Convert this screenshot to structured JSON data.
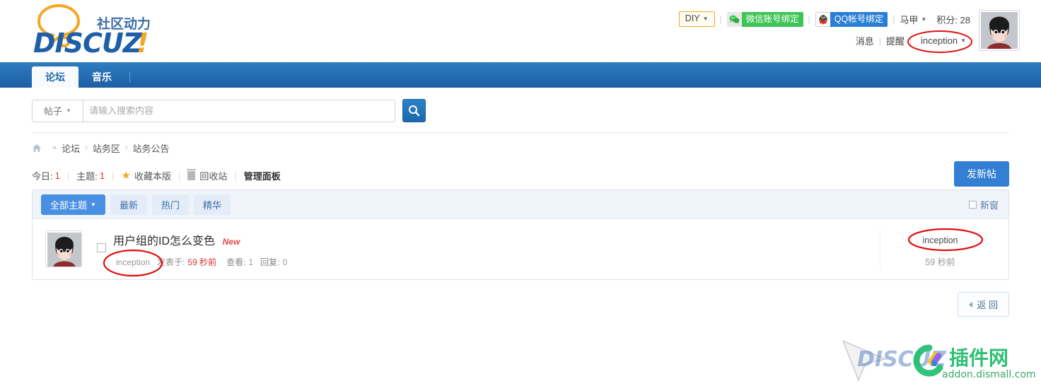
{
  "header": {
    "logo_text": "DISCUZ!",
    "logo_sub": "社区动力",
    "diy_label": "DIY",
    "wechat_bind": "微信账号绑定",
    "qq_bind": "QQ帐号绑定",
    "vest_label": "马甲",
    "points_label": "积分: 28",
    "messages": "消息",
    "reminders": "提醒",
    "username": "inception",
    "separator": "|"
  },
  "nav": {
    "tabs": [
      {
        "label": "论坛",
        "active": true
      },
      {
        "label": "音乐",
        "active": false
      }
    ]
  },
  "search": {
    "scope_label": "帖子",
    "placeholder": "请输入搜索内容",
    "value": "",
    "button_icon": "search-icon"
  },
  "breadcrumb": {
    "home_icon": "home-icon",
    "separator_first": "»",
    "items": [
      "论坛",
      "站务区",
      "站务公告"
    ],
    "arrow": "›"
  },
  "forumbar": {
    "today_label": "今日:",
    "today_count": "1",
    "threads_label": "主题:",
    "threads_count": "1",
    "favorite": "收藏本版",
    "recycle": "回收站",
    "manage_panel": "管理面板",
    "new_thread": "发新帖",
    "divider": "|"
  },
  "list_header": {
    "filters": [
      {
        "label": "全部主题",
        "active": true,
        "has_caret": true
      },
      {
        "label": "最新",
        "active": false,
        "has_caret": false
      },
      {
        "label": "热门",
        "active": false,
        "has_caret": false
      },
      {
        "label": "精华",
        "active": false,
        "has_caret": false
      }
    ],
    "new_window": "新窗"
  },
  "threads": [
    {
      "title": "用户组的ID怎么变色",
      "badge": "New",
      "author": "inception",
      "posted_label": "发表于:",
      "posted_time": "59 秒前",
      "views_label": "查看:",
      "views": "1",
      "replies_label": "回复:",
      "replies": "0",
      "last_poster": "inception",
      "last_time": "59 秒前"
    }
  ],
  "footer": {
    "back_label": "返 回"
  },
  "watermark": {
    "brand": "DISCUZ",
    "cn_text": "插件网",
    "url": "addon.dismall.com"
  },
  "colors": {
    "nav_blue_top": "#2e7cc0",
    "nav_blue_bottom": "#1d5fa4",
    "accent_blue": "#337fd4",
    "red_annotation": "#e01010",
    "new_badge_red": "#e8464a",
    "wechat_green": "#3fc456",
    "qq_blue": "#2a7fd4",
    "diy_orange": "#f0a830"
  }
}
